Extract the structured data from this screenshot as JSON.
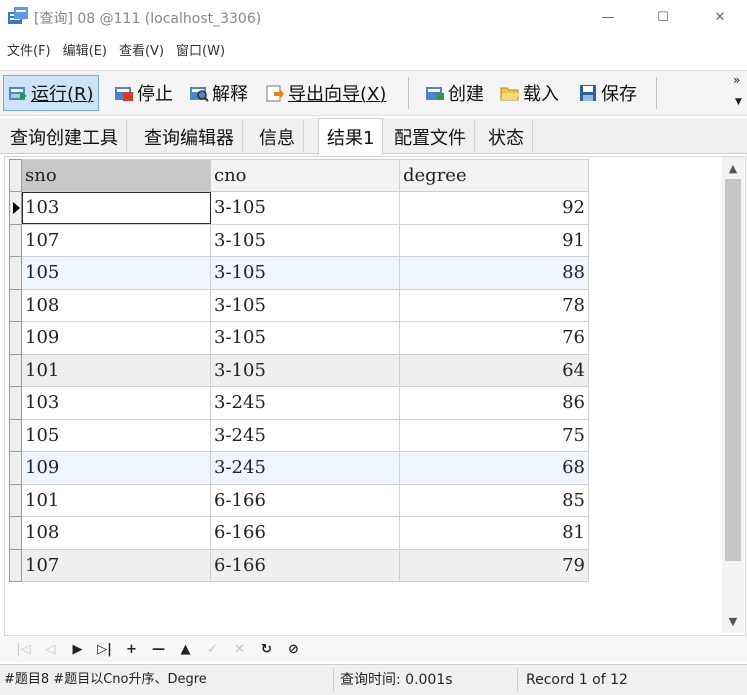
{
  "window": {
    "title": "[查询] 08 @111 (localhost_3306)",
    "minimize": "—",
    "maximize": "☐",
    "close": "✕"
  },
  "menu": [
    "文件(F)",
    "编辑(E)",
    "查看(V)",
    "窗口(W)"
  ],
  "toolbar": {
    "run": "运行(R)",
    "stop": "停止",
    "explain": "解释",
    "export": "导出向导(X)",
    "create": "创建",
    "load": "载入",
    "save": "保存",
    "more": "»",
    "more_down": "▼"
  },
  "tabs": [
    "查询创建工具",
    "查询编辑器",
    "信息",
    "结果1",
    "配置文件",
    "状态"
  ],
  "active_tab": "结果1",
  "grid": {
    "columns": [
      "sno",
      "cno",
      "degree"
    ],
    "rows": [
      [
        "103",
        "3-105",
        "92"
      ],
      [
        "107",
        "3-105",
        "91"
      ],
      [
        "105",
        "3-105",
        "88"
      ],
      [
        "108",
        "3-105",
        "78"
      ],
      [
        "109",
        "3-105",
        "76"
      ],
      [
        "101",
        "3-105",
        "64"
      ],
      [
        "103",
        "3-245",
        "86"
      ],
      [
        "105",
        "3-245",
        "75"
      ],
      [
        "109",
        "3-245",
        "68"
      ],
      [
        "101",
        "6-166",
        "85"
      ],
      [
        "108",
        "6-166",
        "81"
      ],
      [
        "107",
        "6-166",
        "79"
      ]
    ]
  },
  "navigator": [
    "|◁",
    "◁",
    "▶",
    "▷|",
    "+",
    "—",
    "▲",
    "✓",
    "✕",
    "↻",
    "⊘"
  ],
  "status": {
    "sql": "#题目8 #题目以Cno升序、Degre",
    "query_time": "查询时间: 0.001s",
    "record": "Record 1 of 12"
  },
  "colors": {
    "toolbar_active": "#cde3f7",
    "row_highlight": "#eef5fd",
    "header_sorted": "#c8c8c8"
  }
}
